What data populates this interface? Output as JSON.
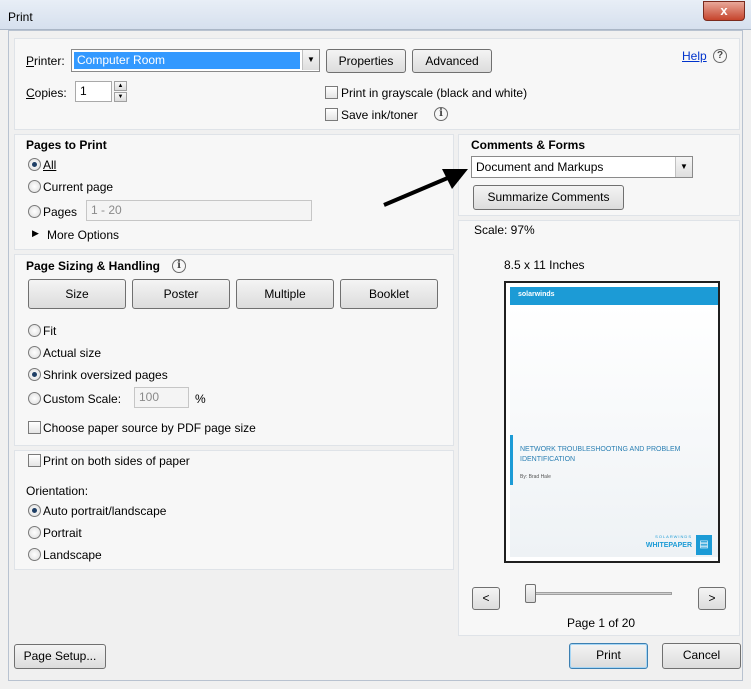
{
  "window": {
    "title": "Print",
    "close_glyph": "x"
  },
  "top": {
    "printer_label": "Printer:",
    "printer_value": "Computer Room",
    "properties_label": "Properties",
    "advanced_label": "Advanced",
    "help_label": "Help",
    "copies_label": "Copies:",
    "copies_value": "1",
    "grayscale_label": "Print in grayscale (black and white)",
    "save_ink_label": "Save ink/toner"
  },
  "pages_to_print": {
    "title": "Pages to Print",
    "all_label": "All",
    "current_label": "Current page",
    "pages_label": "Pages",
    "pages_value": "1 - 20",
    "more_options_label": "More Options",
    "selected": "all"
  },
  "sizing": {
    "title": "Page Sizing & Handling",
    "size_label": "Size",
    "poster_label": "Poster",
    "multiple_label": "Multiple",
    "booklet_label": "Booklet",
    "fit_label": "Fit",
    "actual_label": "Actual size",
    "shrink_label": "Shrink oversized pages",
    "custom_label": "Custom Scale:",
    "custom_value": "100",
    "percent": "%",
    "paper_source_label": "Choose paper source by PDF page size",
    "selected": "shrink"
  },
  "orientation": {
    "both_sides_label": "Print on both sides of paper",
    "title": "Orientation:",
    "auto_label": "Auto portrait/landscape",
    "portrait_label": "Portrait",
    "landscape_label": "Landscape",
    "selected": "auto"
  },
  "comments": {
    "title": "Comments & Forms",
    "value": "Document and Markups",
    "summarize_label": "Summarize Comments"
  },
  "preview": {
    "scale_text": "Scale:  97%",
    "paper_size": "8.5 x 11 Inches",
    "page_logo": "solarwinds",
    "page_title": "NETWORK TROUBLESHOOTING AND PROBLEM IDENTIFICATION",
    "page_author": "By: Brad Hale",
    "page_brand": "SOLARWINDS",
    "page_tag": "WHITEPAPER",
    "prev_glyph": "<",
    "next_glyph": ">",
    "page_indicator": "Page 1 of 20"
  },
  "footer": {
    "page_setup_label": "Page Setup...",
    "print_label": "Print",
    "cancel_label": "Cancel"
  },
  "icons": {
    "info": "info-icon",
    "help": "help-icon",
    "arrow": "arrow-annotation",
    "triangle": "triangle-right-icon"
  },
  "colors": {
    "selection": "#3399ff",
    "link": "#0033cc",
    "accent": "#1c9bd6"
  }
}
